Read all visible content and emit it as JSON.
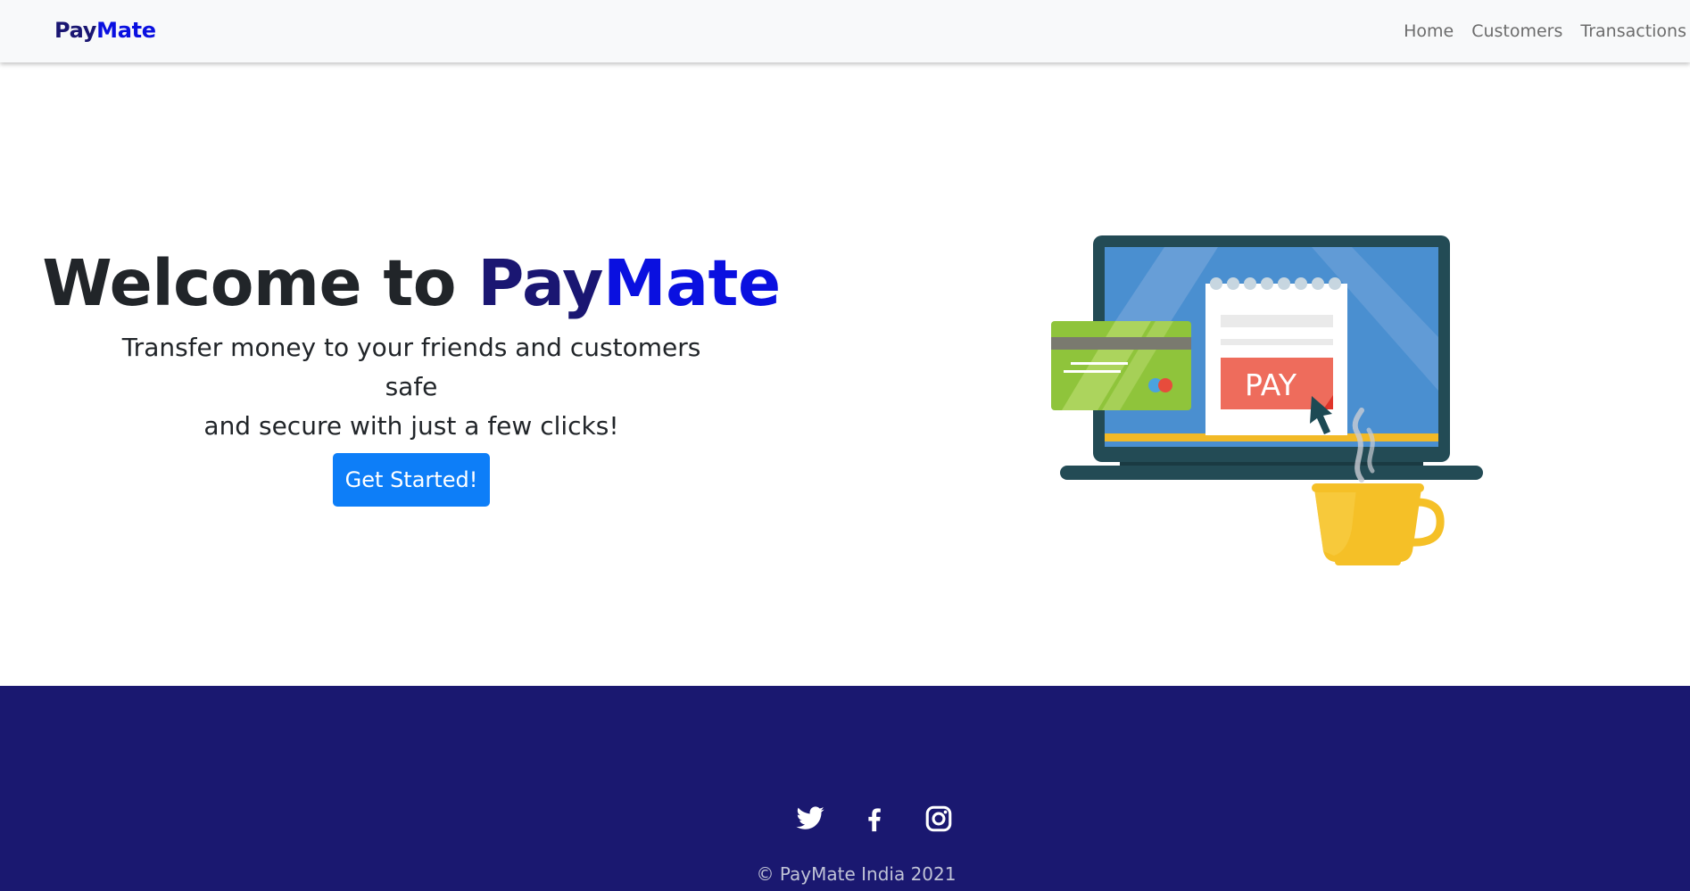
{
  "navbar": {
    "brand_part1": "Pay",
    "brand_part2": "Mate",
    "links": [
      "Home",
      "Customers",
      "Transactions"
    ]
  },
  "hero": {
    "title_prefix": "Welcome to ",
    "title_part1": "Pay",
    "title_part2": "Mate",
    "subtitle_line1": "Transfer money to your friends and customers safe",
    "subtitle_line2": "and secure with just a few clicks!",
    "cta_label": "Get Started!",
    "illustration": {
      "pay_label": "PAY",
      "icon": "laptop-payment-illustration"
    }
  },
  "footer": {
    "social_icons": [
      "twitter-icon",
      "facebook-icon",
      "instagram-icon"
    ],
    "copyright": "© PayMate India 2021"
  },
  "colors": {
    "brand_dark": "#1a1672",
    "brand_bright": "#0a10e0",
    "button": "#0d7ef8",
    "footer_bg": "#1a1870",
    "navbar_bg": "#f8f9fa"
  }
}
